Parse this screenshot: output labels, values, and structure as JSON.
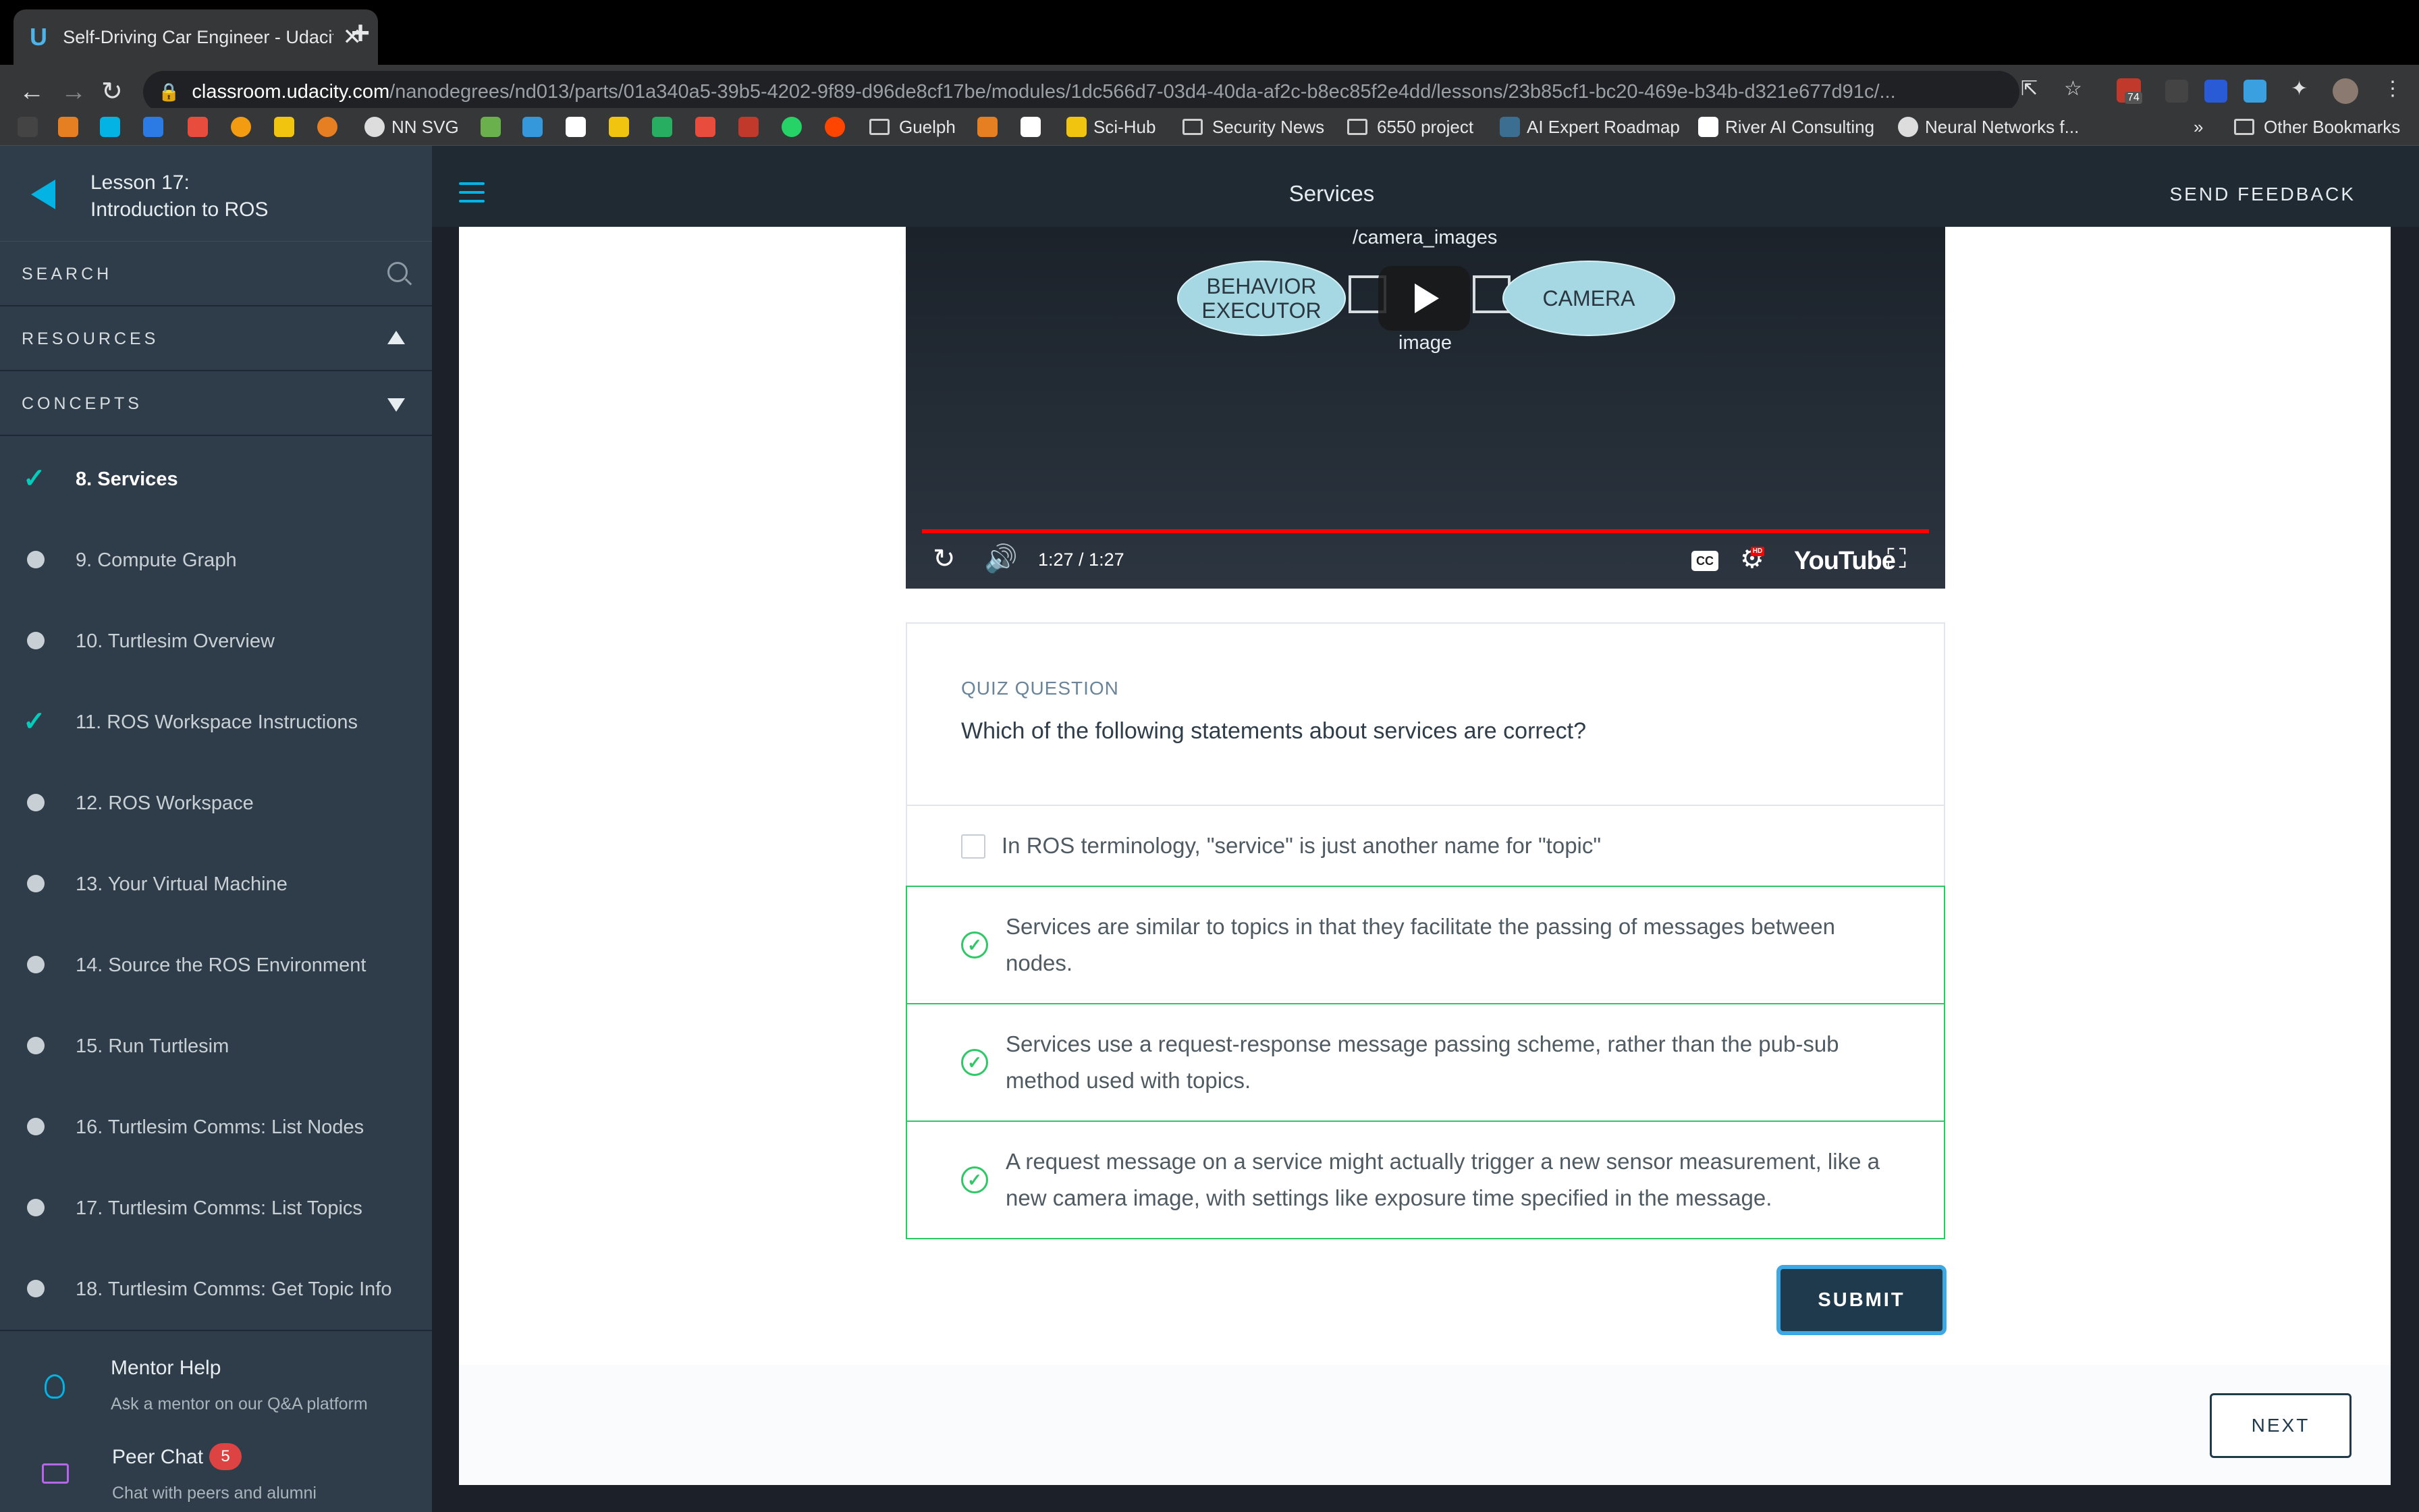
{
  "browser": {
    "tab_title": "Self-Driving Car Engineer - Udacity",
    "url_host": "classroom.udacity.com",
    "url_path": "/nanodegrees/nd013/parts/01a340a5-39b5-4202-9f89-d96de8cf17be/modules/1dc566d7-03d4-40da-af2c-b8ec85f2e4dd/lessons/23b85cf1-bc20-469e-b34b-d321e677d91c/...",
    "extension_badge": "74",
    "bookmarks": [
      "NN SVG",
      "Guelph",
      "Sci-Hub",
      "Security News",
      "6550 project",
      "AI Expert Roadmap",
      "River AI Consulting",
      "Neural Networks f..."
    ],
    "overflow_label": "»",
    "other_bookmarks": "Other Bookmarks"
  },
  "sidebar": {
    "lesson_number": "Lesson 17:",
    "lesson_title": "Introduction to ROS",
    "search_label": "SEARCH",
    "resources_label": "RESOURCES",
    "concepts_label": "CONCEPTS",
    "concepts": [
      {
        "label": "8. Services",
        "status": "complete",
        "active": true
      },
      {
        "label": "9. Compute Graph",
        "status": "incomplete"
      },
      {
        "label": "10. Turtlesim Overview",
        "status": "incomplete"
      },
      {
        "label": "11. ROS Workspace Instructions",
        "status": "complete"
      },
      {
        "label": "12. ROS Workspace",
        "status": "incomplete"
      },
      {
        "label": "13. Your Virtual Machine",
        "status": "incomplete"
      },
      {
        "label": "14. Source the ROS Environment",
        "status": "incomplete"
      },
      {
        "label": "15. Run Turtlesim",
        "status": "incomplete"
      },
      {
        "label": "16. Turtlesim Comms: List Nodes",
        "status": "incomplete"
      },
      {
        "label": "17. Turtlesim Comms: List Topics",
        "status": "incomplete"
      },
      {
        "label": "18. Turtlesim Comms: Get Topic Info",
        "status": "incomplete"
      }
    ],
    "mentor_title": "Mentor Help",
    "mentor_subtitle": "Ask a mentor on our Q&A platform",
    "peer_title": "Peer Chat",
    "peer_badge": "5",
    "peer_subtitle": "Chat with peers and alumni"
  },
  "header": {
    "title": "Services",
    "feedback_label": "SEND FEEDBACK"
  },
  "video": {
    "topic_label": "/camera_images",
    "left_node": "BEHAVIOR EXECUTOR",
    "right_node": "CAMERA",
    "message_label": "image",
    "time": "1:27 / 1:27",
    "progress": 1.0,
    "youtube_label": "YouTube",
    "cc_label": "CC",
    "hd_label": "HD"
  },
  "quiz": {
    "kicker": "QUIZ QUESTION",
    "question": "Which of the following statements about services are correct?",
    "options": [
      {
        "text": "In ROS terminology, \"service\" is just another name for \"topic\"",
        "selected": false
      },
      {
        "text": "Services are similar to topics in that they facilitate the passing of messages between nodes.",
        "selected": true
      },
      {
        "text": "Services use a request-response message passing scheme, rather than the pub-sub method used with topics.",
        "selected": true
      },
      {
        "text": "A request message on a service might actually trigger a new sensor measurement, like a new camera image, with settings like exposure time specified in the message.",
        "selected": true
      }
    ],
    "submit_label": "SUBMIT",
    "next_label": "NEXT"
  },
  "colors": {
    "accent": "#02b3e4",
    "complete": "#02ccba",
    "selected_border": "#2ec866",
    "sidebar_bg": "#2e3d49",
    "nav_bg": "#1f2a33"
  }
}
